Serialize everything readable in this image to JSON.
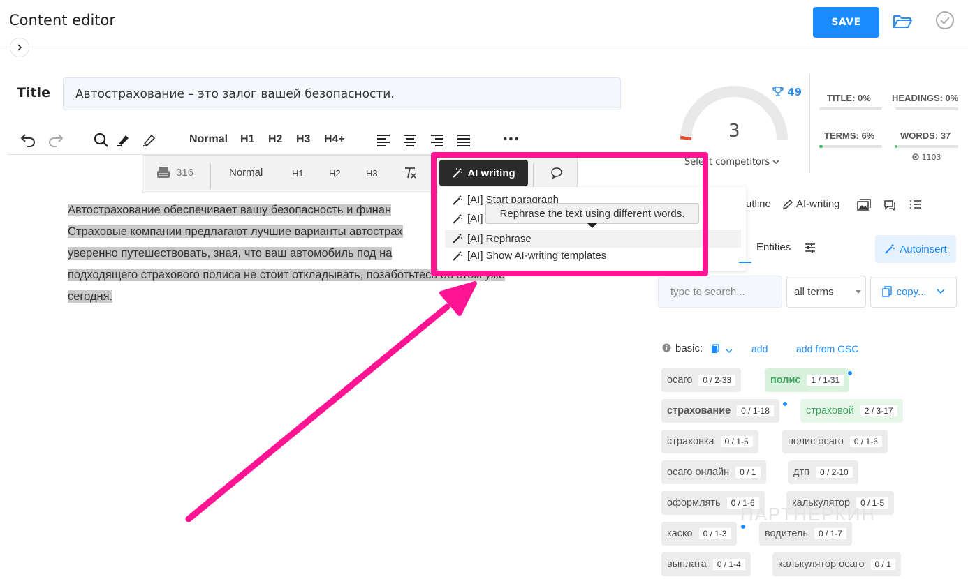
{
  "header": {
    "title": "Content editor",
    "save_label": "SAVE"
  },
  "title_field": {
    "label": "Title",
    "value": "Автострахование – это залог вашей безопасности."
  },
  "toolbar": {
    "normal": "Normal",
    "h1": "H1",
    "h2": "H2",
    "h3": "H3",
    "h4": "H4+",
    "more": "•••"
  },
  "float_toolbar": {
    "count": "316",
    "normal": "Normal",
    "h1": "H1",
    "h2": "H2",
    "h3": "H3",
    "ai_writing": "AI writing"
  },
  "editor": {
    "line1": "Автострахование обеспечивает вашу безопасность и финан",
    "line2": "Страховые компании предлагают лучшие варианты автострах",
    "line3": "уверенно путешествовать, зная, что ваш автомобиль под на",
    "line4": "подходящего страхового полиса не стоит откладывать, позаботьтесь об этом уже",
    "line5": "сегодня."
  },
  "ai_menu": {
    "items": [
      "[AI] Start paragraph",
      "[AI]",
      "[AI] Rephrase",
      "[AI] Show AI-writing templates"
    ],
    "tooltip": "Rephrase the text using different words."
  },
  "score": {
    "trophy_value": "49",
    "competitors": "3",
    "select_competitors": "Select competitors",
    "accent": "#2e8ef0"
  },
  "metrics": {
    "title": "TITLE: 0%",
    "headings": "HEADINGS: 0%",
    "terms": "TERMS: 6%",
    "words": "WORDS: 37",
    "words_sub": "1103",
    "terms_fill": 0.06,
    "words_fill": 0.03
  },
  "panel_tabs": {
    "outline": "utline",
    "ai_writing": "AI-writing",
    "entities": "Entities",
    "autoinsert": "Autoinsert"
  },
  "search": {
    "placeholder": "type to search...",
    "select_value": "all terms",
    "copy": "copy..."
  },
  "basic": {
    "label": "basic:",
    "add": "add",
    "add_gsc": "add from GSC"
  },
  "terms": [
    {
      "name": "осаго",
      "count": "0 / 2-33"
    },
    {
      "name": "полис",
      "count": "1 / 1-31"
    },
    {
      "name": "страхование",
      "count": "0 / 1-18"
    },
    {
      "name": "страховой",
      "count": "2 / 3-17"
    },
    {
      "name": "страховка",
      "count": "0 / 1-5"
    },
    {
      "name": "полис осаго",
      "count": "0 / 1-6"
    },
    {
      "name": "осаго онлайн",
      "count": "0 / 1"
    },
    {
      "name": "дтп",
      "count": "0 / 2-10"
    },
    {
      "name": "оформлять",
      "count": "0 / 1-6"
    },
    {
      "name": "калькулятор",
      "count": "0 / 1-5"
    },
    {
      "name": "каско",
      "count": "0 / 1-3"
    },
    {
      "name": "водитель",
      "count": "0 / 1-7"
    },
    {
      "name": "выплата",
      "count": "0 / 1-4"
    },
    {
      "name": "калькулятор осаго",
      "count": "0 / 1"
    }
  ],
  "watermark": "ПАРТНЕРКИН"
}
